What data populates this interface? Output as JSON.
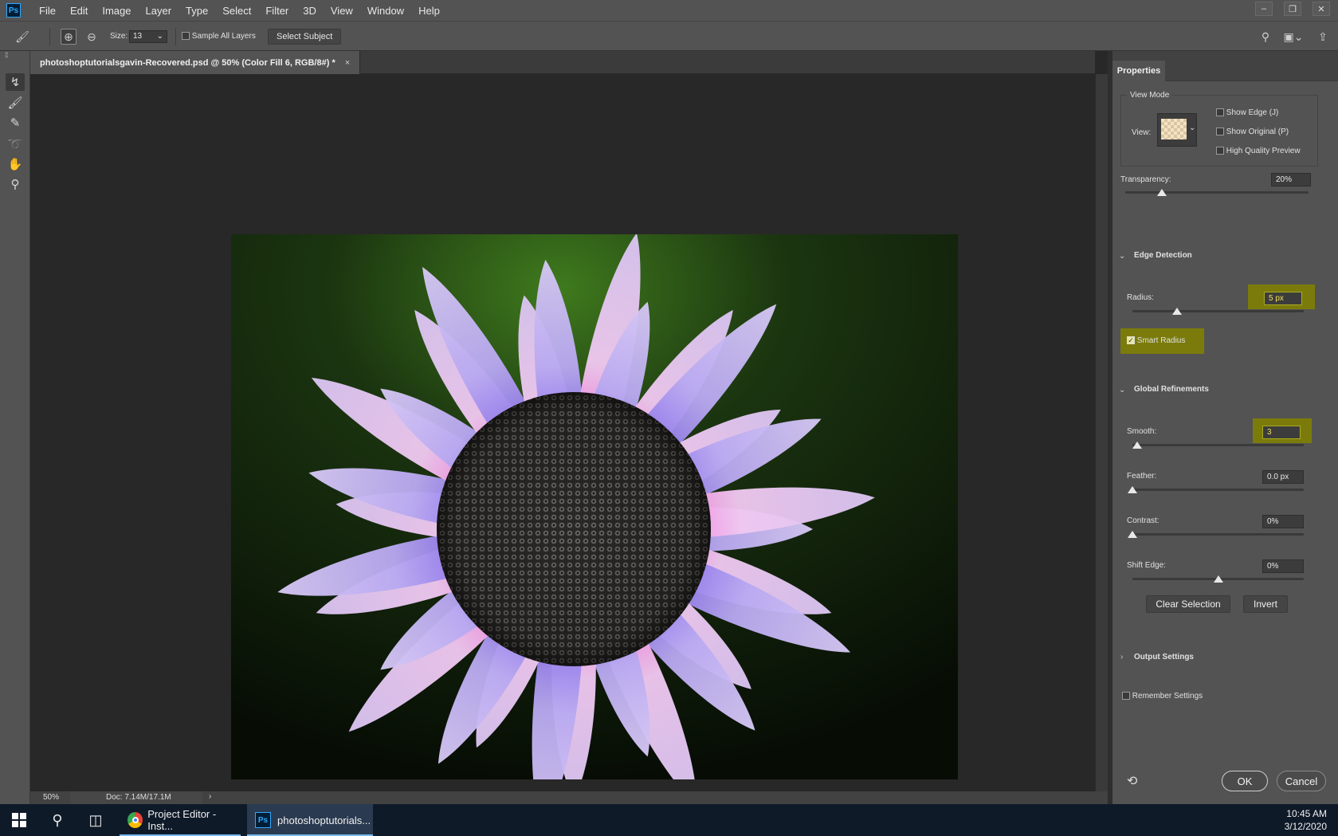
{
  "app": {
    "logo": "Ps"
  },
  "menubar": {
    "items": [
      "File",
      "Edit",
      "Image",
      "Layer",
      "Type",
      "Select",
      "Filter",
      "3D",
      "View",
      "Window",
      "Help"
    ]
  },
  "options_bar": {
    "size_label": "Size:",
    "size_value": "13",
    "sample_all_layers_label": "Sample All Layers",
    "select_subject_label": "Select Subject"
  },
  "document": {
    "tab_title": "photoshoptutorialsgavin-Recovered.psd @ 50% (Color Fill 6, RGB/8#) *",
    "tab_close": "×"
  },
  "status": {
    "zoom": "50%",
    "doc_info": "Doc: 7.14M/17.1M",
    "arrow": "›"
  },
  "properties": {
    "tab": "Properties",
    "view_mode": {
      "title": "View Mode",
      "view_label": "View:",
      "show_edge": "Show Edge (J)",
      "show_original": "Show Original (P)",
      "high_quality": "High Quality Preview"
    },
    "transparency": {
      "label": "Transparency:",
      "value": "20%",
      "level": 0.2
    },
    "edge_detection": {
      "title": "Edge Detection",
      "radius_label": "Radius:",
      "radius_value": "5 px",
      "radius_level": 0.26,
      "smart_radius": "Smart Radius",
      "smart_radius_checked": true
    },
    "global_refinements": {
      "title": "Global Refinements",
      "smooth_label": "Smooth:",
      "smooth_value": "3",
      "smooth_level": 0.03,
      "feather_label": "Feather:",
      "feather_value": "0.0 px",
      "feather_level": 0.0,
      "contrast_label": "Contrast:",
      "contrast_value": "0%",
      "contrast_level": 0.0,
      "shift_edge_label": "Shift Edge:",
      "shift_edge_value": "0%",
      "shift_edge_level": 0.5,
      "clear_selection": "Clear Selection",
      "invert": "Invert"
    },
    "output_settings": {
      "title": "Output Settings"
    },
    "remember_settings": "Remember Settings",
    "ok": "OK",
    "cancel": "Cancel",
    "highlight_color": "#828200"
  },
  "taskbar": {
    "apps": [
      {
        "label": "Project Editor - Inst...",
        "icon": "chrome-icon"
      },
      {
        "label": "photoshoptutorials...",
        "icon": "photoshop-icon"
      }
    ],
    "time": "10:45 AM",
    "date": "3/12/2020"
  },
  "colors": {
    "petal_purple": "#5a2ee0",
    "petal_magenta": "#ff1fc4",
    "petal_light": "#d9c2f2",
    "seed_head": "#3a3936",
    "background_green": "#1d3a12"
  }
}
